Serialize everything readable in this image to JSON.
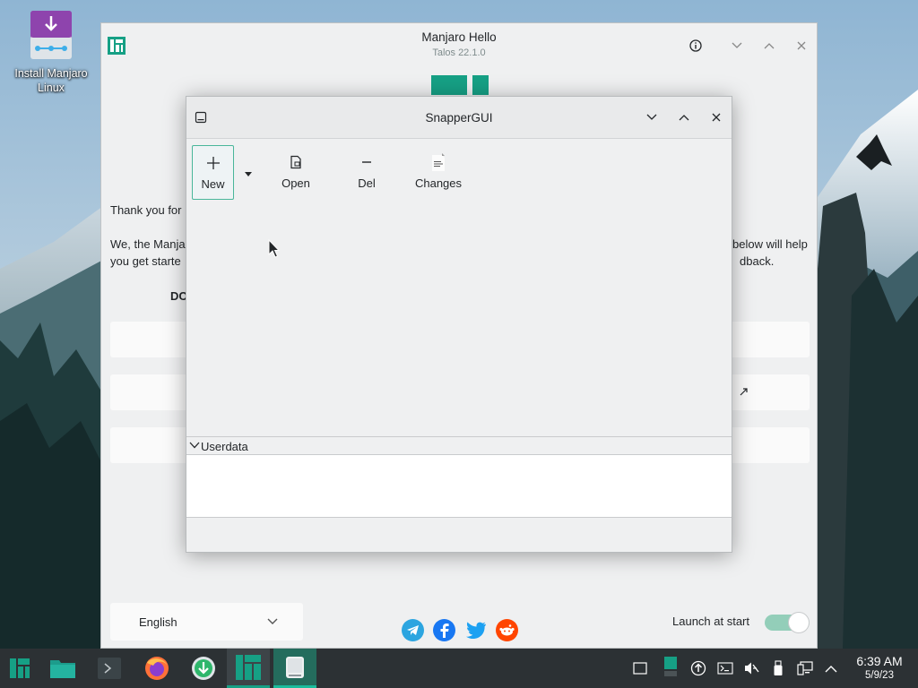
{
  "desktop": {
    "icon_label": "Install Manjaro Linux"
  },
  "hello": {
    "title": "Manjaro Hello",
    "subtitle": "Talos 22.1.0",
    "thank_you": "Thank you for",
    "para_left_1": "We, the Manja",
    "para_left_2": "you get starte",
    "para_right_1": "below will help",
    "para_right_2": "dback.",
    "doc_heading": "DO",
    "language": "English",
    "launch_at_start": "Launch at start",
    "launch_at_start_on": true
  },
  "snapper": {
    "title": "SnapperGUI",
    "toolbar": {
      "new": "New",
      "open": "Open",
      "del": "Del",
      "changes": "Changes"
    },
    "group": "Userdata"
  },
  "colors": {
    "accent": "#16a085",
    "taskbar": "#2c3134",
    "window_bg": "#eff0f1"
  },
  "taskbar": {
    "time": "6:39 AM",
    "date": "5/9/23",
    "launchers": [
      "manjaro-menu-icon",
      "file-manager-icon",
      "terminal-icon",
      "firefox-icon",
      "pamac-icon",
      "manjaro-hello-icon",
      "snapper-gui-icon"
    ],
    "tray": [
      "show-desktop-icon",
      "clipboard-icon",
      "updates-icon",
      "terminal-tray-icon",
      "audio-muted-icon",
      "usb-icon",
      "network-icon",
      "tray-expand-icon"
    ]
  }
}
